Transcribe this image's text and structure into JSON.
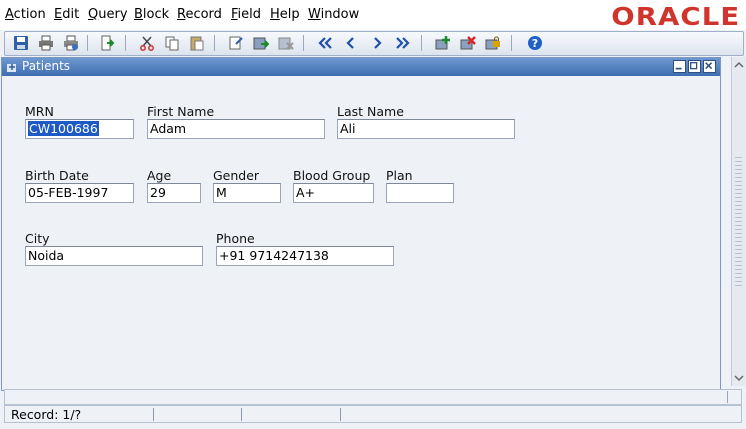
{
  "menu": {
    "items": [
      {
        "label": "Action",
        "ul": "A",
        "rest": "ction"
      },
      {
        "label": "Edit",
        "ul": "E",
        "rest": "dit"
      },
      {
        "label": "Query",
        "ul": "Q",
        "rest": "uery"
      },
      {
        "label": "Block",
        "ul": "B",
        "rest": "lock"
      },
      {
        "label": "Record",
        "ul": "R",
        "rest": "ecord"
      },
      {
        "label": "Field",
        "ul": "F",
        "rest": "ield"
      },
      {
        "label": "Help",
        "ul": "H",
        "rest": "elp"
      },
      {
        "label": "Window",
        "ul": "W",
        "rest": "indow"
      }
    ],
    "logo": "ORACLE"
  },
  "toolbar": {
    "icons": [
      "save-icon",
      "print-icon",
      "print-setup-icon",
      "exit-icon",
      "cut-icon",
      "copy-icon",
      "paste-icon",
      "enter-query-icon",
      "execute-query-icon",
      "cancel-query-icon",
      "previous-block-icon",
      "previous-record-icon",
      "next-record-icon",
      "next-block-icon",
      "insert-record-icon",
      "delete-record-icon",
      "lock-record-icon",
      "help-icon"
    ]
  },
  "window": {
    "title": "Patients"
  },
  "form": {
    "mrn": {
      "label": "MRN",
      "value": "CW100686"
    },
    "first_name": {
      "label": "First Name",
      "value": "Adam"
    },
    "last_name": {
      "label": "Last Name",
      "value": "Ali"
    },
    "birth_date": {
      "label": "Birth Date",
      "value": "05-FEB-1997"
    },
    "age": {
      "label": "Age",
      "value": "29"
    },
    "gender": {
      "label": "Gender",
      "value": "M"
    },
    "blood_group": {
      "label": "Blood Group",
      "value": "A+"
    },
    "plan": {
      "label": "Plan",
      "value": ""
    },
    "city": {
      "label": "City",
      "value": "Noida"
    },
    "phone": {
      "label": "Phone",
      "value": "+91 9714247138"
    }
  },
  "status": {
    "record": "Record: 1/?"
  },
  "colors": {
    "logo": "#d0342c",
    "title_bar": "#3e6db0",
    "selection": "#1e5ac4"
  }
}
